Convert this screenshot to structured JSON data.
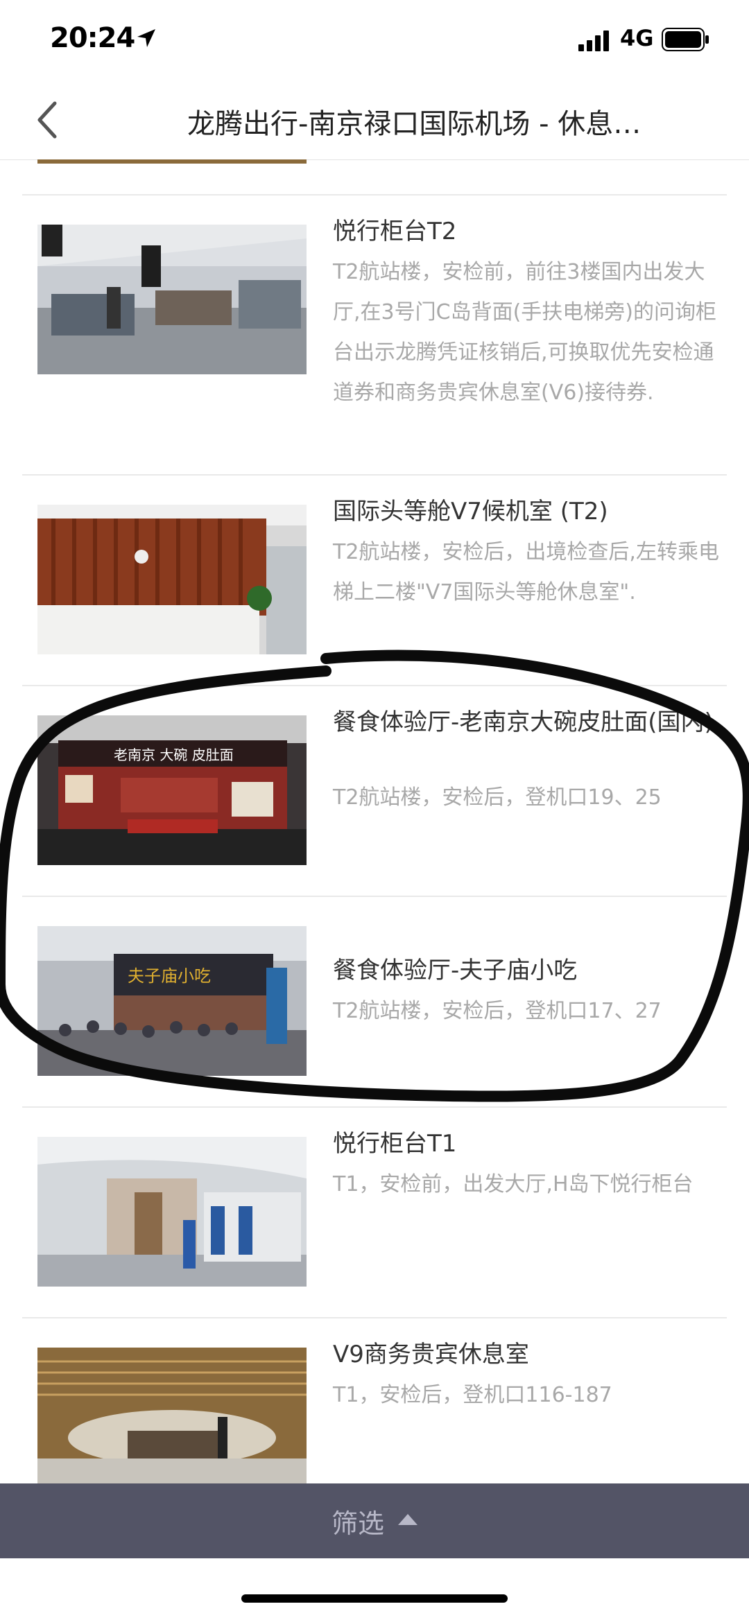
{
  "status_bar": {
    "time": "20:24",
    "network": "4G"
  },
  "nav": {
    "title": "龙腾出行-南京禄口国际机场 - 休息…"
  },
  "items": [
    {
      "title": "悦行柜台T2",
      "desc": "T2航站楼，安检前，前往3楼国内出发大厅,在3号门C岛背面(手扶电梯旁)的问询柜台出示龙腾凭证核销后,可换取优先安检通道券和商务贵宾休息室(V6)接待券."
    },
    {
      "title": "国际头等舱V7候机室 (T2)",
      "desc": "T2航站楼，安检后，出境检查后,左转乘电梯上二楼\"V7国际头等舱休息室\"."
    },
    {
      "title": "餐食体验厅-老南京大碗皮肚面(国内)",
      "desc": "T2航站楼，安检后，登机口19、25"
    },
    {
      "title": "餐食体验厅-夫子庙小吃",
      "desc": "T2航站楼，安检后，登机口17、27"
    },
    {
      "title": "悦行柜台T1",
      "desc": "T1，安检前，出发大厅,H岛下悦行柜台"
    },
    {
      "title": "V9商务贵宾休息室",
      "desc": "T1，安检后，登机口116-187"
    }
  ],
  "thumb_text": {
    "item3_sign": "老南京 大碗 皮肚面",
    "item4_sign": "夫子庙小吃"
  },
  "filter": {
    "label": "筛选"
  },
  "colors": {
    "filter_bar": "#535466",
    "desc_text": "#a8a8a8",
    "title_text": "#333333"
  }
}
